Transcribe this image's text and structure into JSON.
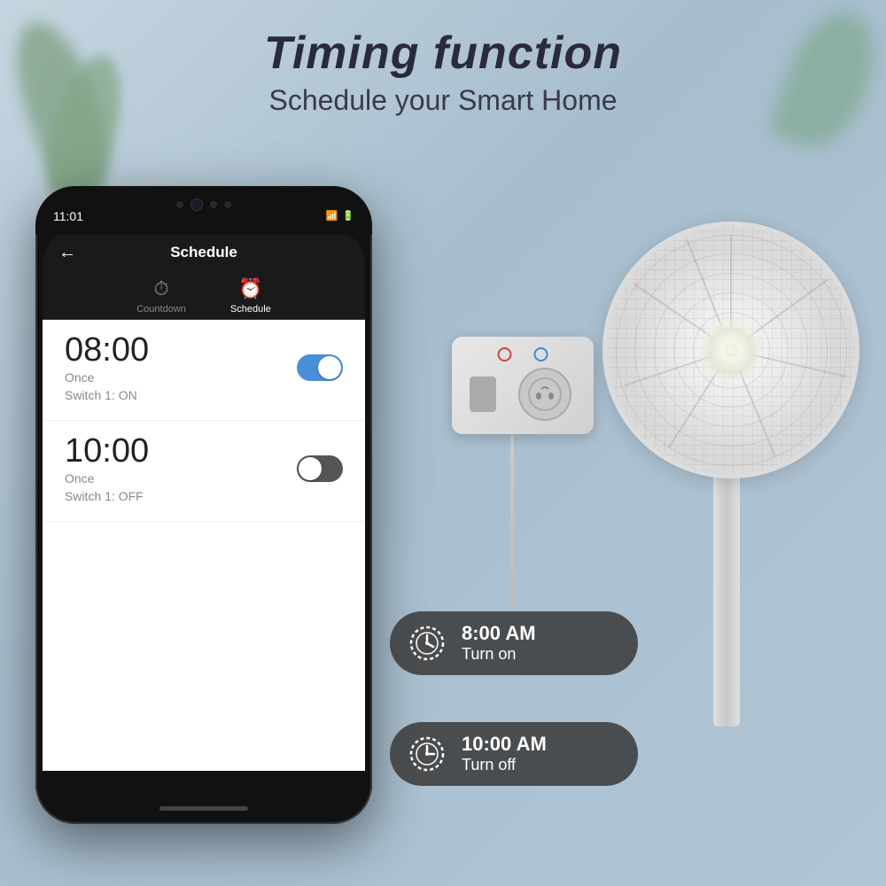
{
  "page": {
    "title": "Timing function",
    "subtitle": "Schedule your Smart Home"
  },
  "phone": {
    "status_time": "11:01",
    "status_icons": "⊙ □ ▲",
    "app_title": "Schedule",
    "back_icon": "←",
    "tabs": [
      {
        "label": "Countdown",
        "active": false,
        "icon": "⏱"
      },
      {
        "label": "Schedule",
        "active": true,
        "icon": "⏰"
      }
    ],
    "schedules": [
      {
        "time": "08:00",
        "frequency": "Once",
        "switch_info": "Switch 1: ON",
        "toggle_state": "on"
      },
      {
        "time": "10:00",
        "frequency": "Once",
        "switch_info": "Switch 1: OFF",
        "toggle_state": "off"
      }
    ]
  },
  "notifications": [
    {
      "time": "8:00 AM",
      "action": "Turn on",
      "id": "turn-on"
    },
    {
      "time": "10:00 AM",
      "action": "Turn off",
      "id": "turn-off"
    }
  ],
  "colors": {
    "toggle_on": "#4a90d9",
    "toggle_off": "#555555",
    "pill_bg": "rgba(60,60,60,0.88)",
    "header_title": "#2a2a3a",
    "header_sub": "#3a3a4a"
  }
}
